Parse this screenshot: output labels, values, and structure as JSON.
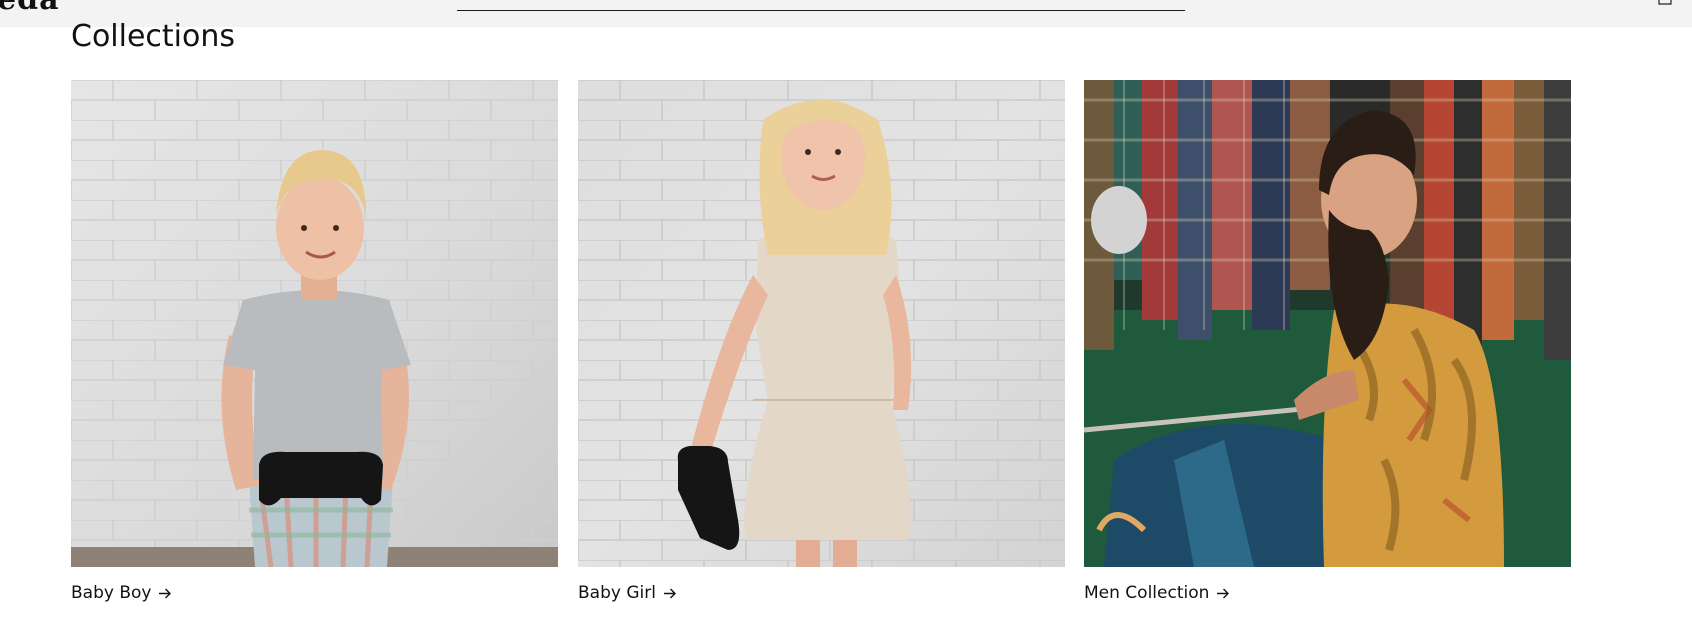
{
  "header": {
    "logo_text": "eda",
    "icons": [
      "search-field-underline",
      "cart-icon"
    ]
  },
  "section": {
    "title": "Collections"
  },
  "collections": [
    {
      "label": "Baby Boy",
      "icon": "arrow-right-icon"
    },
    {
      "label": "Baby Girl",
      "icon": "arrow-right-icon"
    },
    {
      "label": "Men Collection",
      "icon": "arrow-right-icon"
    }
  ],
  "colors": {
    "header_background": "#f3f3f3",
    "text": "#121212",
    "page_background": "#ffffff"
  }
}
